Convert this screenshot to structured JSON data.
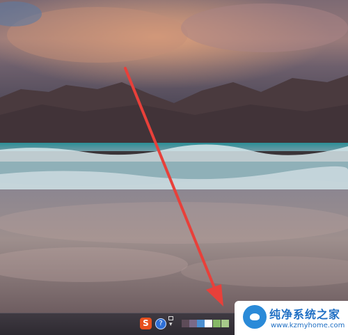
{
  "desktop": {
    "wallpaper": "beach-mountains-sunset",
    "arrow_color": "#e8403a"
  },
  "taskbar": {
    "ime_icon_label": "S",
    "help_icon_label": "?",
    "swatch_colors": [
      "#5d4b58",
      "#7a6a88",
      "#4b8fd1",
      "#ffffff",
      "#86b866",
      "#a7c98a"
    ]
  },
  "watermark": {
    "title": "纯净系统之家",
    "url": "www.kzmyhome.com"
  }
}
